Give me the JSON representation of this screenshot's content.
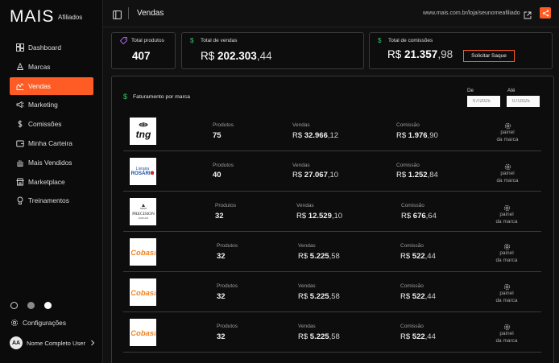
{
  "brand": {
    "logo": "MAIS",
    "subtitle": "Afiliados"
  },
  "sidebar": {
    "items": [
      {
        "label": "Dashboard",
        "icon": "dashboard-icon",
        "active": false
      },
      {
        "label": "Marcas",
        "icon": "brand-icon",
        "active": false
      },
      {
        "label": "Vendas",
        "icon": "sales-icon",
        "active": true
      },
      {
        "label": "Marketing",
        "icon": "megaphone-icon",
        "active": false
      },
      {
        "label": "Comissões",
        "icon": "dollar-icon",
        "active": false
      },
      {
        "label": "Minha Carteira",
        "icon": "wallet-icon",
        "active": false
      },
      {
        "label": "Mais Vendidos",
        "icon": "hand-icon",
        "active": false
      },
      {
        "label": "Marketplace",
        "icon": "store-icon",
        "active": false
      },
      {
        "label": "Treinamentos",
        "icon": "training-icon",
        "active": false
      }
    ],
    "settings_label": "Configurações",
    "user_initials": "AA",
    "user_name": "Nome Completo User"
  },
  "header": {
    "title": "Vendas",
    "url": "www.mais.com.br/loja/seunomeafiliado"
  },
  "stats": {
    "products": {
      "label": "Total produtos",
      "value": "407"
    },
    "sales": {
      "label": "Total de vendas",
      "prefix": "R$ ",
      "int": "202.303",
      "dec": ",44"
    },
    "commission": {
      "label": "Total de comissões",
      "prefix": "R$ ",
      "int": "21.357",
      "dec": ",98",
      "button": "Solicitar Saque"
    }
  },
  "panel": {
    "title": "Faturamento por marca",
    "from_label": "De",
    "to_label": "Até",
    "from_value": "07/2025",
    "to_value": "07/2025"
  },
  "columns": {
    "products": "Produtos",
    "sales": "Vendas",
    "commission": "Comissão",
    "link_line1": "painel",
    "link_line2": "da marca"
  },
  "rows": [
    {
      "brand": "tng",
      "products": "75",
      "sales_prefix": "R$ ",
      "sales_int": "32.966",
      "sales_dec": ",12",
      "comm_prefix": "R$ ",
      "comm_int": "1.976",
      "comm_dec": ",90"
    },
    {
      "brand": "Rosário",
      "products": "40",
      "sales_prefix": "R$ ",
      "sales_int": "27.067",
      "sales_dec": ",10",
      "comm_prefix": "R$ ",
      "comm_int": "1.252",
      "comm_dec": ",84"
    },
    {
      "brand": "Precision",
      "products": "32",
      "sales_prefix": "R$ ",
      "sales_int": "12.529",
      "sales_dec": ",10",
      "comm_prefix": "R$ ",
      "comm_int": "676",
      "comm_dec": ",64"
    },
    {
      "brand": "Cobasi",
      "products": "32",
      "sales_prefix": "R$ ",
      "sales_int": "5.225",
      "sales_dec": ",58",
      "comm_prefix": "R$ ",
      "comm_int": "522",
      "comm_dec": ",44"
    },
    {
      "brand": "Cobasi",
      "products": "32",
      "sales_prefix": "R$ ",
      "sales_int": "5.225",
      "sales_dec": ",58",
      "comm_prefix": "R$ ",
      "comm_int": "522",
      "comm_dec": ",44"
    },
    {
      "brand": "Cobasi",
      "products": "32",
      "sales_prefix": "R$ ",
      "sales_int": "5.225",
      "sales_dec": ",58",
      "comm_prefix": "R$ ",
      "comm_int": "522",
      "comm_dec": ",44"
    }
  ],
  "colors": {
    "accent": "#fe5c24",
    "cobasi": "#f58220",
    "tng": "#111111",
    "rosario": "#1c4b9c"
  }
}
